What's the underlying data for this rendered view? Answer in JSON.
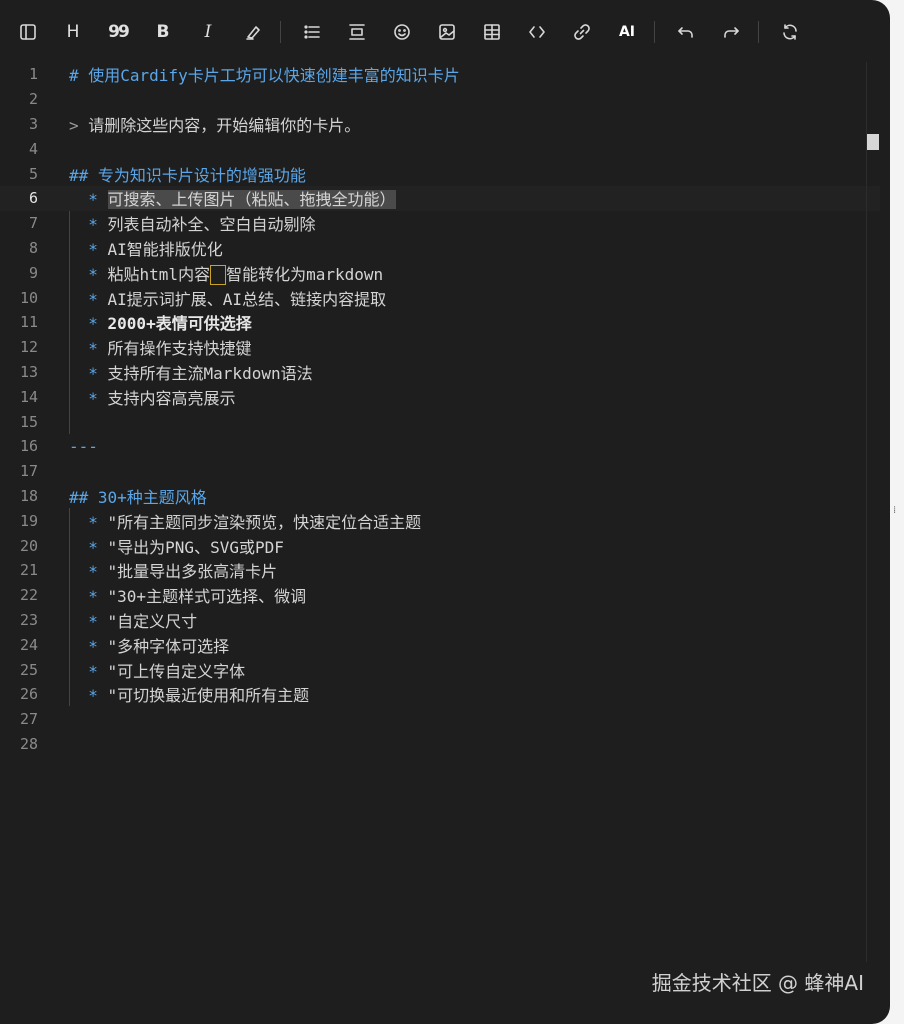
{
  "toolbar": {
    "items": [
      {
        "name": "toggle-sidebar",
        "icon": "sidebar-icon"
      },
      {
        "name": "heading",
        "icon": "heading-icon",
        "label": "H"
      },
      {
        "name": "quote",
        "icon": "quote-icon",
        "label": "99"
      },
      {
        "name": "bold",
        "icon": "bold-icon",
        "label": "B"
      },
      {
        "name": "italic",
        "icon": "italic-icon",
        "label": "I"
      },
      {
        "name": "highlight",
        "icon": "highlighter-icon"
      },
      {
        "name": "list",
        "icon": "list-icon"
      },
      {
        "name": "align",
        "icon": "align-icon"
      },
      {
        "name": "emoji",
        "icon": "emoji-icon"
      },
      {
        "name": "image",
        "icon": "image-icon"
      },
      {
        "name": "table",
        "icon": "table-icon"
      },
      {
        "name": "code",
        "icon": "code-icon"
      },
      {
        "name": "link",
        "icon": "link-icon"
      },
      {
        "name": "ai",
        "icon": "ai-icon",
        "label": "AI"
      },
      {
        "name": "undo",
        "icon": "undo-icon"
      },
      {
        "name": "redo",
        "icon": "redo-icon"
      },
      {
        "name": "refresh",
        "icon": "refresh-icon"
      }
    ]
  },
  "editor": {
    "current_line": 6,
    "line_numbers": [
      "1",
      "2",
      "3",
      "4",
      "5",
      "6",
      "7",
      "8",
      "9",
      "10",
      "11",
      "12",
      "13",
      "14",
      "15",
      "16",
      "17",
      "18",
      "19",
      "20",
      "21",
      "22",
      "23",
      "24",
      "25",
      "26",
      "27",
      "28"
    ],
    "lines": {
      "l1_mark": "# ",
      "l1_text": "使用Cardify卡片工坊可以快速创建丰富的知识卡片",
      "l3_mark": "> ",
      "l3_text": "请删除这些内容，开始编辑你的卡片。",
      "l5_mark": "## ",
      "l5_text": "专为知识卡片设计的增强功能",
      "l6_text": "可搜索、上传图片（粘贴、拖拽全功能）",
      "l7_text": "列表自动补全、空白自动剔除",
      "l8_text": "AI智能排版优化",
      "l9_text_a": "粘贴html内容",
      "l9_text_b": "智能转化为markdown",
      "l10_text": "AI提示词扩展、AI总结、链接内容提取",
      "l11_text": "2000+表情可供选择",
      "l12_text": "所有操作支持快捷键",
      "l13_text": "支持所有主流Markdown语法",
      "l14_text": "支持内容高亮展示",
      "l16_text": "---",
      "l18_mark": "## ",
      "l18_text": "30+种主题风格",
      "l19_text": "\"所有主题同步渲染预览，快速定位合适主题",
      "l20_text": "\"导出为PNG、SVG或PDF",
      "l21_text": "\"批量导出多张高清卡片",
      "l22_text": "\"30+主题样式可选择、微调",
      "l23_text": "\"自定义尺寸",
      "l24_text": "\"多种字体可选择",
      "l25_text": "\"可上传自定义字体",
      "l26_text": "\"可切换最近使用和所有主题",
      "bullet": "* "
    }
  },
  "watermark": "掘金技术社区 @ 蜂神AI",
  "colors": {
    "background": "#1e1e1e",
    "heading": "#5aa6e8",
    "text": "#d4d4d4",
    "line_number": "#8a8a8a",
    "cursor_box": "#c9a227"
  }
}
